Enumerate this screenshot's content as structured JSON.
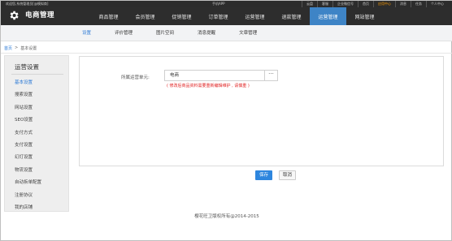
{
  "topbar": {
    "welcome": "欢迎您,系统管理员[@模拟商]",
    "app": "手机APP",
    "links": [
      "云盘",
      "客服",
      "企业微信号",
      "首页",
      "应用中心",
      "消息",
      "任务",
      "个人中心"
    ]
  },
  "header": {
    "brand": "电商管理",
    "nav": [
      "商品管理",
      "会员管理",
      "促销管理",
      "订单管理",
      "运营管理",
      "退款管理",
      "运营管理",
      "网站管理"
    ]
  },
  "subnav": {
    "items": [
      "设置",
      "评价管理",
      "图片空间",
      "消息提醒",
      "文章管理"
    ]
  },
  "breadcrumb": {
    "home": "首页",
    "sep": ">",
    "current": "基本设置"
  },
  "sidebar": {
    "title": "运营设置",
    "items": [
      "基本设置",
      "搜索设置",
      "网站设置",
      "SEO设置",
      "支付方式",
      "支付设置",
      "幻灯设置",
      "物流设置",
      "自动拆单配置",
      "注册协议",
      "我的店铺"
    ]
  },
  "form": {
    "label": "所属运营单元:",
    "value": "电商",
    "dots": "···",
    "hint": "( 修改后商品资料需要重新编辑维护 , 请慎重 )"
  },
  "buttons": {
    "save": "保存",
    "cancel": "取消"
  },
  "footer": {
    "copyright": "樱花旺卫版权所有@2014-2015"
  },
  "colors": {
    "accent": "#3e84c6",
    "link": "#2e7bd6",
    "warning": "#e02020",
    "header_bg": "#2d2d2d",
    "highlight": "#ff9d00"
  }
}
